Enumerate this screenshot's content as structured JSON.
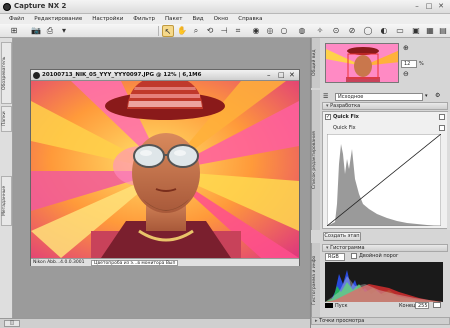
{
  "app": {
    "title": "Capture NX 2"
  },
  "window_controls": {
    "minimize": "–",
    "maximize": "□",
    "close": "✕"
  },
  "menu": [
    "Файл",
    "Редактирование",
    "Настройки",
    "Фильтр",
    "Пакет",
    "Вид",
    "Окно",
    "Справка"
  ],
  "left_tabs": [
    "Обозреватель",
    "Папки",
    "Метаданные"
  ],
  "image_window": {
    "title": "20100713_NIK_05_YYY_YYY0097.JPG @ 12% | 6,1M6",
    "status_left": "Nikon Abb...4.0.0.3001",
    "status_mode": "Цветопроба из э...в монитора Вып"
  },
  "right_panel": {
    "bird_eye_tab": "Общий вид",
    "edit_tab": "Список редактирования",
    "zoom_value": "12",
    "zoom_unit": "%",
    "preset_value": "Исходное",
    "develop_label": "Разработка",
    "quickfix_label": "Quick Fix",
    "quickfix_sub": "Quick Fix",
    "create_step": "Создать этап",
    "histogram_tab": "Гистограмма и инфо",
    "histogram_label": "Гистограмма",
    "channel": "RGB",
    "double_threshold": "Двойной порог",
    "start_label": "Пуск",
    "end_label": "Конец",
    "end_value": "255",
    "bottom_label": "Точки просмотра"
  },
  "colors": {
    "accent": "#316ac5"
  }
}
